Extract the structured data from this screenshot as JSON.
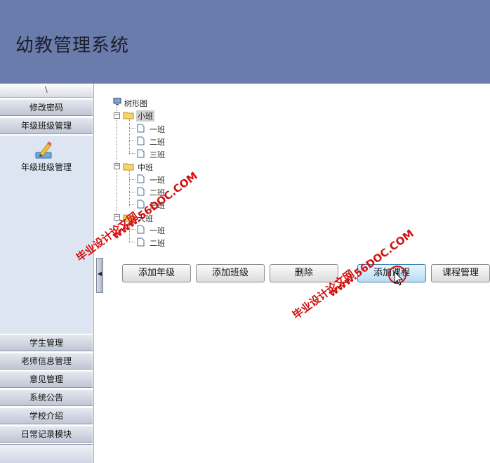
{
  "app": {
    "title": "幼教管理系统"
  },
  "sidebar": {
    "top_mark": "\\",
    "items": [
      {
        "label": "修改密码"
      },
      {
        "label": "年级班级管理"
      },
      {
        "label": "学生管理"
      },
      {
        "label": "老师信息管理"
      },
      {
        "label": "意见管理"
      },
      {
        "label": "系统公告"
      },
      {
        "label": "学校介绍"
      },
      {
        "label": "日常记录模块"
      }
    ],
    "panel": {
      "icon": "pencil-icon",
      "label": "年级班级管理"
    }
  },
  "tree": {
    "root": {
      "label": "树形图",
      "icon": "computer-icon"
    },
    "grades": [
      {
        "label": "小班",
        "selected": true,
        "classes": [
          "一班",
          "二班",
          "三班"
        ]
      },
      {
        "label": "中班",
        "selected": false,
        "classes": [
          "一班",
          "二班",
          "三班"
        ]
      },
      {
        "label": "大班",
        "selected": false,
        "classes": [
          "一班",
          "二班"
        ]
      }
    ],
    "toggle_symbol": "−"
  },
  "actions": {
    "add_grade": "添加年级",
    "add_class": "添加班级",
    "delete": "删除",
    "add_course": "添加课程",
    "course_manage": "课程管理"
  },
  "watermarks": {
    "line1": "毕业设计论文网",
    "line2": "www.56DOC.COM",
    "color": "#d01010"
  },
  "colors": {
    "header": "#6a7cab",
    "sidebar_panel": "#dde5f3"
  }
}
